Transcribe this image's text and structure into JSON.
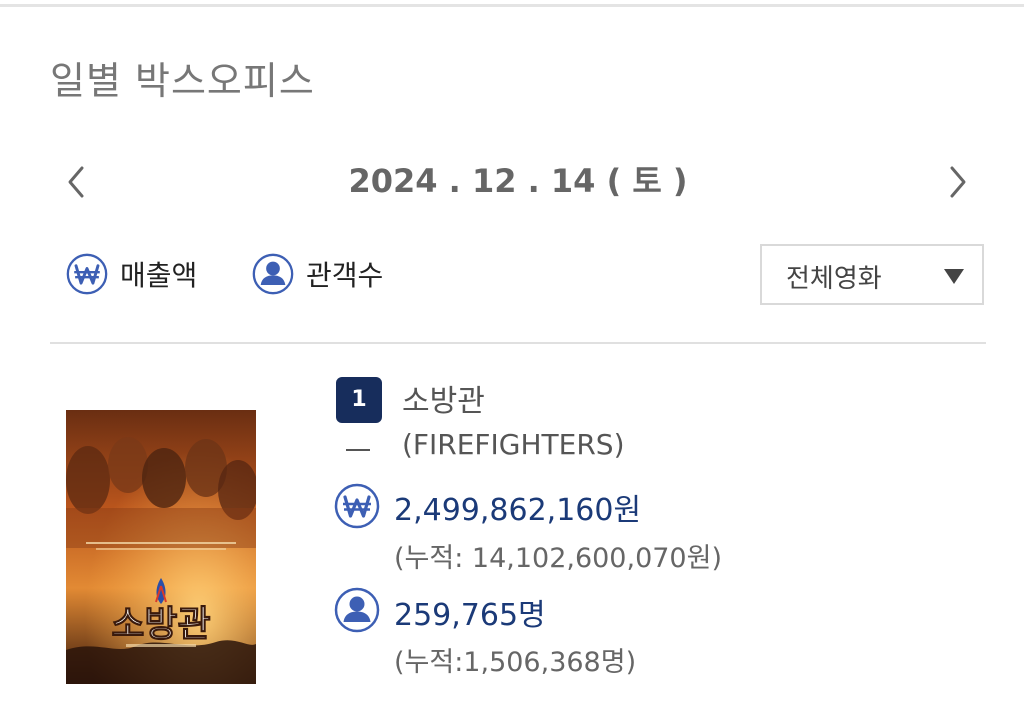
{
  "header": {
    "title": "일별 박스오피스"
  },
  "date_nav": {
    "date": "2024 . 12 . 14 ( 토 )",
    "prev_icon": "chevron-left-icon",
    "next_icon": "chevron-right-icon"
  },
  "toggles": {
    "sales_label": "매출액",
    "sales_icon": "won-icon",
    "audience_label": "관객수",
    "audience_icon": "person-icon"
  },
  "filter": {
    "selected": "전체영화",
    "icon": "caret-down-icon"
  },
  "colors": {
    "accent_navy": "#172d5c",
    "value_blue": "#1b3a78",
    "icon_blue": "#3d5fb4"
  },
  "movies": [
    {
      "rank": "1",
      "rank_change": "–",
      "title": "소방관",
      "title_en": "(FIREFIGHTERS)",
      "poster_title": "소방관",
      "sales": "2,499,862,160원",
      "sales_cum": "(누적: 14,102,600,070원)",
      "audience": "259,765명",
      "audience_cum": "(누적:1,506,368명)"
    }
  ]
}
